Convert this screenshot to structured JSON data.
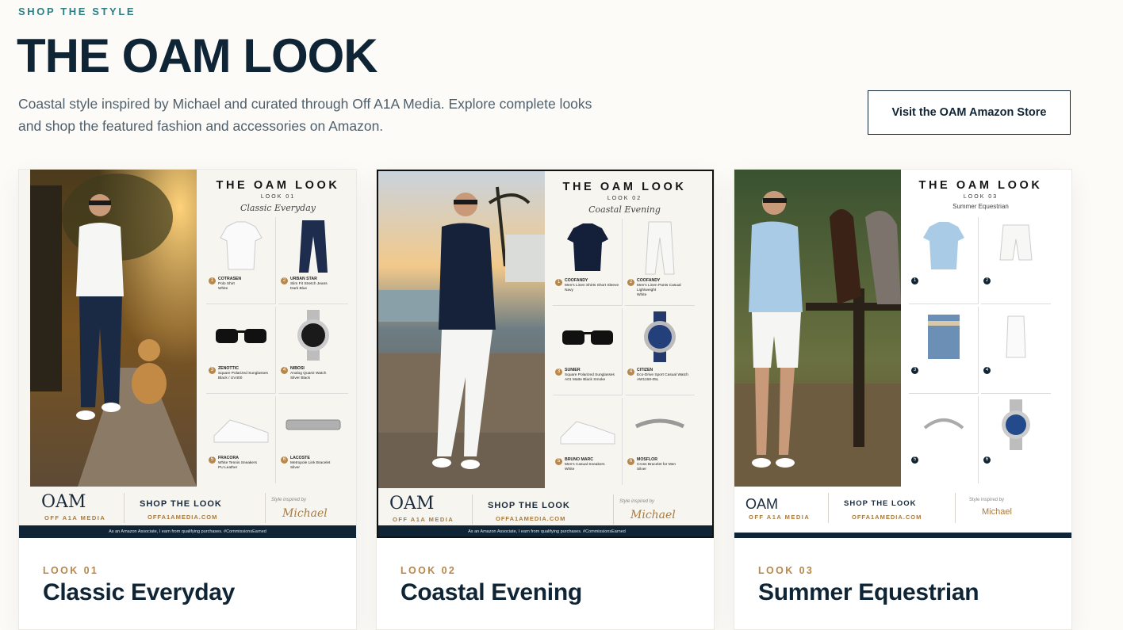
{
  "header": {
    "eyebrow": "SHOP THE STYLE",
    "title": "THE OAM LOOK",
    "intro": "Coastal style inspired by Michael and curated through Off A1A Media. Explore complete looks and shop the featured fashion and accessories on Amazon.",
    "cta_label": "Visit the OAM Amazon Store"
  },
  "colors": {
    "navy": "#0f2535",
    "teal": "#2e7f84",
    "gold": "#b8874a"
  },
  "looks": [
    {
      "kicker": "LOOK 01",
      "title": "Classic Everyday",
      "poster": {
        "title": "THE OAM LOOK",
        "sub": "LOOK 01",
        "name": "Classic Everyday",
        "items": [
          {
            "n": "1",
            "brand": "COTRASEN",
            "desc": "Polo Shirt",
            "color": "White"
          },
          {
            "n": "2",
            "brand": "URBAN STAR",
            "desc": "Slim Fit Stretch Jeans",
            "color": "Dark Blue"
          },
          {
            "n": "3",
            "brand": "ZENOTTIC",
            "desc": "Square Polarized Sunglasses",
            "color": "Black / UV400"
          },
          {
            "n": "4",
            "brand": "NIBOSI",
            "desc": "Analog Quartz Watch",
            "color": "Silver Black"
          },
          {
            "n": "5",
            "brand": "FRACORA",
            "desc": "White Tennis Sneakers",
            "color": "PU Leather"
          },
          {
            "n": "6",
            "brand": "LACOSTE",
            "desc": "Metropole Link Bracelet",
            "color": "Silver"
          }
        ],
        "logo": "OAM",
        "logo_sub": "OFF A1A MEDIA",
        "shop": "SHOP THE LOOK",
        "url": "OFFA1AMEDIA.COM",
        "inspired": "Style inspired by",
        "signature": "Michael",
        "disclaimer": "As an Amazon Associate, I earn from qualifying purchases. #CommissionsEarned"
      }
    },
    {
      "kicker": "LOOK 02",
      "title": "Coastal Evening",
      "poster": {
        "title": "THE OAM LOOK",
        "sub": "LOOK 02",
        "name": "Coastal Evening",
        "items": [
          {
            "n": "1",
            "brand": "COOFANDY",
            "desc": "Men's Linen Shirts Short Sleeve",
            "color": "Navy"
          },
          {
            "n": "2",
            "brand": "COOFANDY",
            "desc": "Men's Linen Pants Casual Lightweight",
            "color": "White"
          },
          {
            "n": "3",
            "brand": "SUNIER",
            "desc": "Square Polarized Sunglasses",
            "color": "A01 Matte Black Smoke"
          },
          {
            "n": "4",
            "brand": "CITIZEN",
            "desc": "Eco-Drive Sport Casual Watch",
            "color": "AW1158-05L"
          },
          {
            "n": "5",
            "brand": "BRUNO MARC",
            "desc": "Men's Casual Sneakers",
            "color": "White"
          },
          {
            "n": "6",
            "brand": "MOSFLOR",
            "desc": "Cross Bracelet for Men",
            "color": "Silver"
          }
        ],
        "logo": "OAM",
        "logo_sub": "OFF A1A MEDIA",
        "shop": "SHOP THE LOOK",
        "url": "OFFA1AMEDIA.COM",
        "inspired": "Style inspired by",
        "signature": "Michael",
        "disclaimer": "As an Amazon Associate, I earn from qualifying purchases. #CommissionsEarned"
      }
    },
    {
      "kicker": "LOOK 03",
      "title": "Summer Equestrian",
      "poster": {
        "title": "THE OAM LOOK",
        "sub": "LOOK 03",
        "name": "Summer Equestrian",
        "items": [
          {
            "n": "1",
            "brand": "",
            "desc": "",
            "color": ""
          },
          {
            "n": "2",
            "brand": "",
            "desc": "",
            "color": ""
          },
          {
            "n": "3",
            "brand": "",
            "desc": "",
            "color": ""
          },
          {
            "n": "4",
            "brand": "",
            "desc": "",
            "color": ""
          },
          {
            "n": "5",
            "brand": "",
            "desc": "",
            "color": ""
          },
          {
            "n": "6",
            "brand": "",
            "desc": "",
            "color": ""
          }
        ],
        "logo": "OAM",
        "logo_sub": "OFF A1A MEDIA",
        "shop": "SHOP THE LOOK",
        "url": "OFFA1AMEDIA.COM",
        "inspired": "Style inspired by",
        "signature": "Michael",
        "disclaimer": ""
      }
    }
  ]
}
